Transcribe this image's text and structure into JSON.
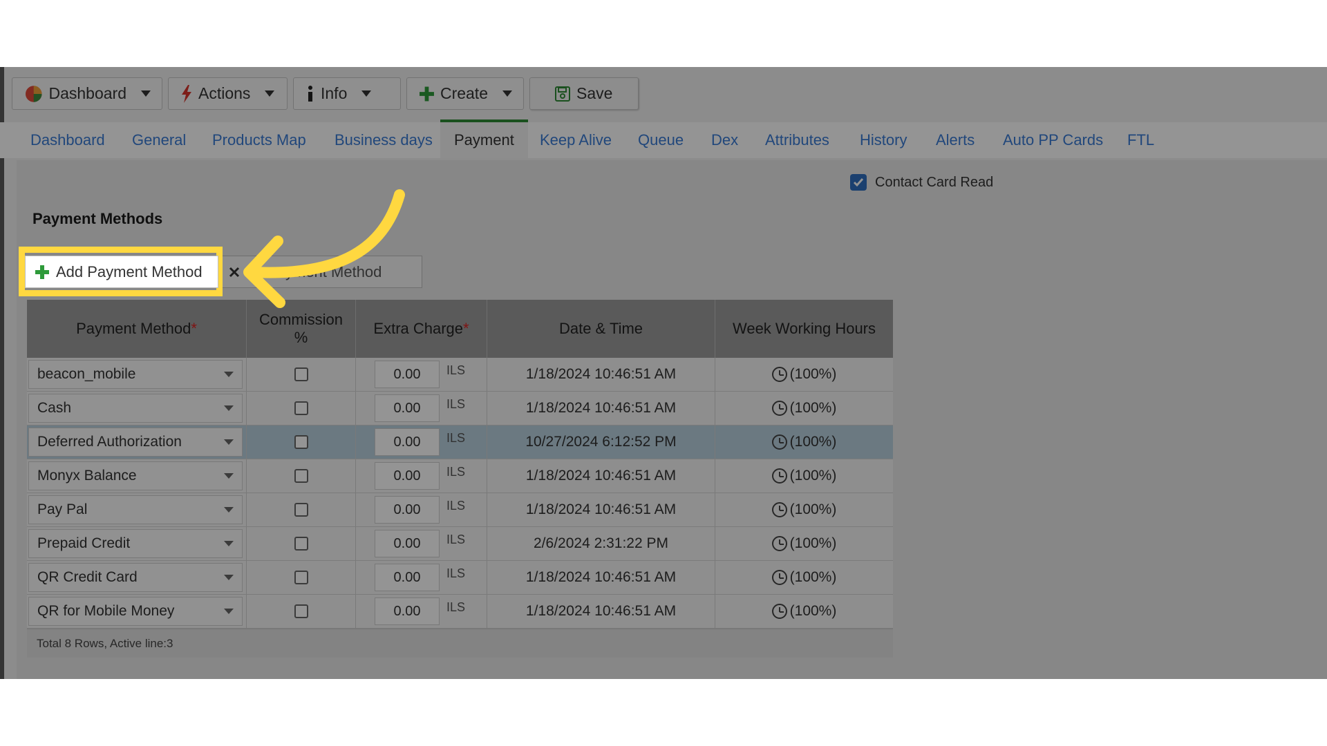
{
  "toolbar": {
    "dashboard": "Dashboard",
    "actions": "Actions",
    "info": "Info",
    "create": "Create",
    "save": "Save"
  },
  "tabs": [
    "Dashboard",
    "General",
    "Products Map",
    "Business days",
    "Payment",
    "Keep Alive",
    "Queue",
    "Dex",
    "Attributes",
    "History",
    "Alerts",
    "Auto PP Cards",
    "FTL"
  ],
  "contact_card_read": "Contact Card Read",
  "section_title": "Payment Methods",
  "add_button": "Add Payment Method",
  "delete_button_visible": "yment Method",
  "columns": {
    "payment_method": "Payment Method",
    "commission": "Commission %",
    "extra_charge": "Extra Charge",
    "date_time": "Date & Time",
    "week_hours": "Week Working Hours"
  },
  "rows": [
    {
      "method": "beacon_mobile",
      "amount": "0.00",
      "currency": "ILS",
      "date": "1/18/2024 10:46:51 AM",
      "hours": "(100%)"
    },
    {
      "method": "Cash",
      "amount": "0.00",
      "currency": "ILS",
      "date": "1/18/2024 10:46:51 AM",
      "hours": "(100%)"
    },
    {
      "method": "Deferred Authorization",
      "amount": "0.00",
      "currency": "ILS",
      "date": "10/27/2024 6:12:52 PM",
      "hours": "(100%)"
    },
    {
      "method": "Monyx Balance",
      "amount": "0.00",
      "currency": "ILS",
      "date": "1/18/2024 10:46:51 AM",
      "hours": "(100%)"
    },
    {
      "method": "Pay Pal",
      "amount": "0.00",
      "currency": "ILS",
      "date": "1/18/2024 10:46:51 AM",
      "hours": "(100%)"
    },
    {
      "method": "Prepaid Credit",
      "amount": "0.00",
      "currency": "ILS",
      "date": "2/6/2024 2:31:22 PM",
      "hours": "(100%)"
    },
    {
      "method": "QR Credit Card",
      "amount": "0.00",
      "currency": "ILS",
      "date": "1/18/2024 10:46:51 AM",
      "hours": "(100%)"
    },
    {
      "method": "QR for Mobile Money",
      "amount": "0.00",
      "currency": "ILS",
      "date": "1/18/2024 10:46:51 AM",
      "hours": "(100%)"
    }
  ],
  "footer": "Total 8 Rows, Active line:3",
  "colors": {
    "highlight": "#ffd840",
    "tab_active_border": "#2e8b34",
    "link": "#3a7bd5",
    "active_row": "#b8d0de"
  }
}
